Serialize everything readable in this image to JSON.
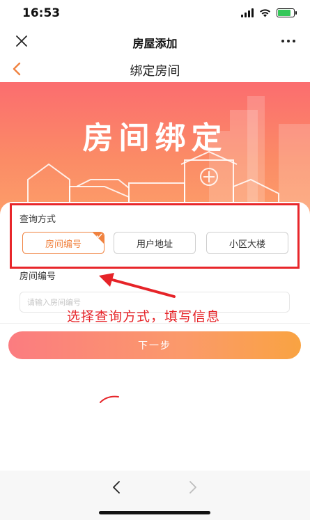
{
  "status_bar": {
    "time": "16:53",
    "icons": [
      "signal-icon",
      "wifi-icon",
      "battery-charging-icon"
    ],
    "battery_color": "#34c759"
  },
  "title_bar": {
    "title": "房屋添加",
    "left_icon": "close-icon",
    "right_icon": "more-icon"
  },
  "nav_bar": {
    "title": "绑定房间",
    "back_icon": "chevron-left-icon",
    "accent_color": "#f0823f"
  },
  "banner": {
    "title": "房间绑定",
    "gradient": [
      "#fb6d6f",
      "#fca06a"
    ]
  },
  "query": {
    "label": "查询方式",
    "options": [
      {
        "label": "房间编号",
        "selected": true
      },
      {
        "label": "用户地址",
        "selected": false
      },
      {
        "label": "小区大楼",
        "selected": false
      }
    ],
    "highlight_color": "#e8262a"
  },
  "room_field": {
    "label": "房间编号",
    "placeholder": "请输入房间编号",
    "value": ""
  },
  "annotation": {
    "text": "选择查询方式，填写信息",
    "color": "#e62328"
  },
  "next_button": {
    "label": "下一步"
  },
  "browser_bar": {
    "back_icon": "chevron-left-icon",
    "forward_icon": "chevron-right-icon"
  }
}
